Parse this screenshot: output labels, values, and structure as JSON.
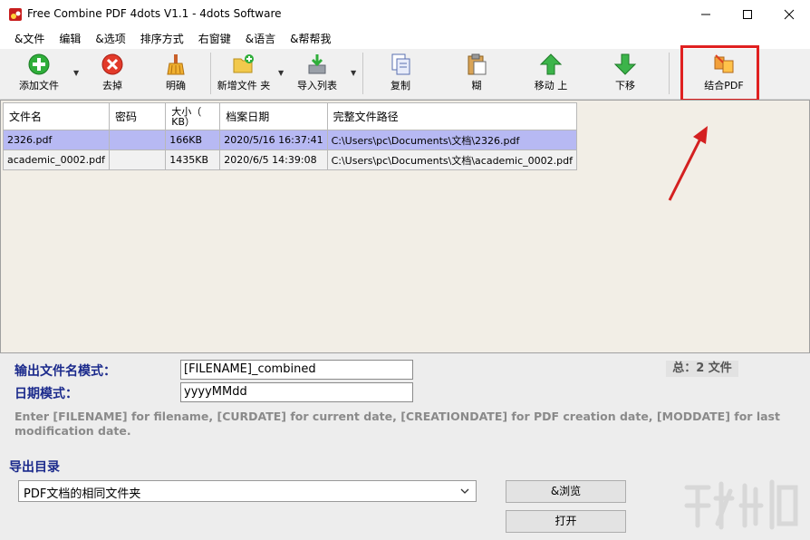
{
  "window": {
    "title": "Free Combine PDF 4dots V1.1 - 4dots Software"
  },
  "menu": [
    "&文件",
    "编辑",
    "&选项",
    "排序方式",
    "右窗键",
    "&语言",
    "&帮帮我"
  ],
  "toolbar": {
    "add_file": "添加文件",
    "remove": "去掉",
    "clear": "明确",
    "add_folder": "新增文件 夹",
    "import_list": "导入列表",
    "copy": "复制",
    "paste": "糊",
    "move_up": "移动 上",
    "move_down": "下移",
    "combine": "结合PDF"
  },
  "table": {
    "headers": [
      "文件名",
      "密码",
      "大小（KB）",
      "档案日期",
      "完整文件路径"
    ],
    "size_header_line1": "大小（",
    "size_header_line2": "KB）",
    "rows": [
      {
        "name": "2326.pdf",
        "password": "",
        "size": "166KB",
        "date": "2020/5/16 16:37:41",
        "path": "C:\\Users\\pc\\Documents\\文档\\2326.pdf"
      },
      {
        "name": "academic_0002.pdf",
        "password": "",
        "size": "1435KB",
        "date": "2020/6/5 14:39:08",
        "path": "C:\\Users\\pc\\Documents\\文档\\academic_0002.pdf"
      }
    ]
  },
  "output": {
    "filename_pattern_label": "输出文件名模式：",
    "filename_pattern_value": "[FILENAME]_combined",
    "date_pattern_label": "日期模式：",
    "date_pattern_value": "yyyyMMdd",
    "total": "总：2 文件",
    "hint": "Enter [FILENAME] for filename, [CURDATE] for current date, [CREATIONDATE] for PDF creation date, [MODDATE] for last modification date.",
    "folder_label": "导出目录",
    "folder_selected": "PDF文档的相同文件夹",
    "browse": "&浏览",
    "open": "打开"
  },
  "colors": {
    "highlight": "#e02020",
    "selected_row": "#b7b9f3",
    "label_blue": "#1b2a8c"
  }
}
